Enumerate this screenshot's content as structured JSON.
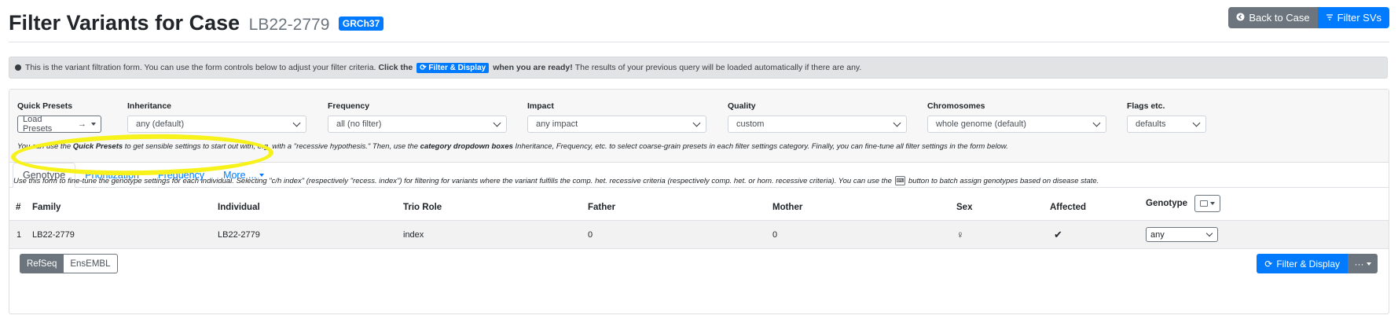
{
  "header": {
    "title": "Filter Variants for Case",
    "case_name": "LB22-2779",
    "build_badge": "GRCh37",
    "back_label": "Back to Case",
    "filter_svs_label": "Filter SVs"
  },
  "alert": {
    "text1": "This is the variant filtration form. You can use the form controls below to adjust your filter criteria.",
    "click_the": "Click the",
    "button_label": "Filter & Display",
    "when_ready": "when you are ready!",
    "text2": "The results of your previous query will be loaded automatically if there are any."
  },
  "presets": {
    "quick_presets": {
      "label": "Quick Presets",
      "value": "Load Presets"
    },
    "inheritance": {
      "label": "Inheritance",
      "value": "any (default)"
    },
    "frequency": {
      "label": "Frequency",
      "value": "all (no filter)"
    },
    "impact": {
      "label": "Impact",
      "value": "any impact"
    },
    "quality": {
      "label": "Quality",
      "value": "custom"
    },
    "chromosomes": {
      "label": "Chromosomes",
      "value": "whole genome (default)"
    },
    "flags": {
      "label": "Flags etc.",
      "value": "defaults"
    },
    "help_a": "You can use the",
    "help_b": "Quick Presets",
    "help_c": "to get sensible settings to start out with, e.g. with a \"recessive hypothesis.\" Then, use the",
    "help_d": "category dropdown boxes",
    "help_e": "Inheritance, Frequency, etc. to select coarse-grain presets in each filter settings category. Finally, you can fine-tune all filter settings in the form below."
  },
  "tabs": [
    {
      "label": "Genotype"
    },
    {
      "label": "Prioritization"
    },
    {
      "label": "Frequency"
    },
    {
      "label": "More ..."
    }
  ],
  "genotype_help": {
    "before": "Use this form to fine-tune the genotype settings for each individual. Selecting \"c/h index\" (respectively \"recess. index\") for filtering for variants where the variant fulfills the comp. het. recessive criteria (respectively comp. het. or hom. recessive criteria). You can use the",
    "after": "button to batch assign genotypes based on disease state."
  },
  "table": {
    "headers": [
      "#",
      "Family",
      "Individual",
      "Trio Role",
      "Father",
      "Mother",
      "Sex",
      "Affected",
      "Genotype"
    ],
    "rows": [
      {
        "num": "1",
        "family": "LB22-2779",
        "individual": "LB22-2779",
        "role": "index",
        "father": "0",
        "mother": "0",
        "sex": "♀",
        "affected": "✔",
        "genotype": "any"
      }
    ]
  },
  "bottom": {
    "refseq": "RefSeq",
    "ensembl": "EnsEMBL",
    "filter_display": "Filter & Display",
    "more": "···"
  },
  "colors": {
    "primary": "#007bff",
    "secondary": "#6c757d",
    "highlight": "#f7f21a"
  }
}
